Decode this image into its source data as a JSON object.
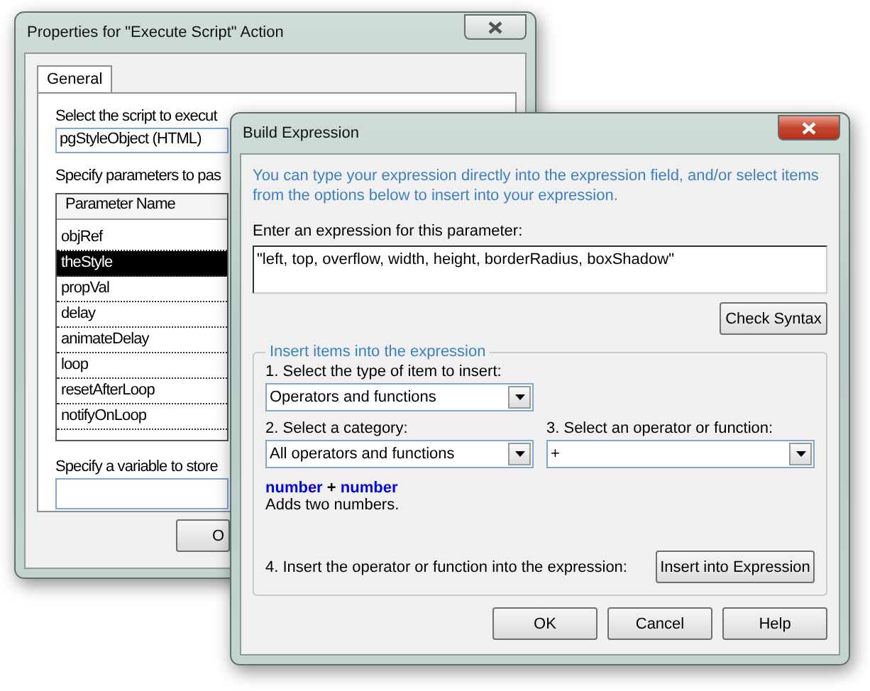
{
  "back_window": {
    "title": "Properties for \"Execute Script\" Action",
    "tabs": [
      {
        "label": "General",
        "selected": true
      }
    ],
    "script_label": "Select the script to execut",
    "script_value": "pgStyleObject (HTML)",
    "params_label": "Specify parameters to pas",
    "params_header": "Parameter Name",
    "params": [
      {
        "name": "objRef",
        "selected": false
      },
      {
        "name": "theStyle",
        "selected": true
      },
      {
        "name": "propVal",
        "selected": false
      },
      {
        "name": "delay",
        "selected": false
      },
      {
        "name": "animateDelay",
        "selected": false
      },
      {
        "name": "loop",
        "selected": false
      },
      {
        "name": "resetAfterLoop",
        "selected": false
      },
      {
        "name": "notifyOnLoop",
        "selected": false
      }
    ],
    "variable_label": "Specify a variable to store",
    "button": "O"
  },
  "front_window": {
    "title": "Build Expression",
    "intro": "You can type your expression directly into the expression field, and/or select items from the options below to insert into your expression.",
    "expression_label": "Enter an expression for this parameter:",
    "expression_value": "\"left, top, overflow, width, height, borderRadius, boxShadow\"",
    "check_syntax": "Check Syntax",
    "group_title": "Insert items into the expression",
    "type_label": "1. Select the type of item to insert:",
    "type_value": "Operators and functions",
    "category_label": "2. Select a category:",
    "category_value": "All operators and functions",
    "operator_label": "3. Select an operator or function:",
    "operator_value": "+",
    "signature": {
      "left": "number",
      "op": "+",
      "right": "number"
    },
    "description": "Adds two numbers.",
    "insert_label": "4. Insert the operator or function into the expression:",
    "insert_button": "Insert into Expression",
    "buttons": [
      "OK",
      "Cancel",
      "Help"
    ]
  }
}
